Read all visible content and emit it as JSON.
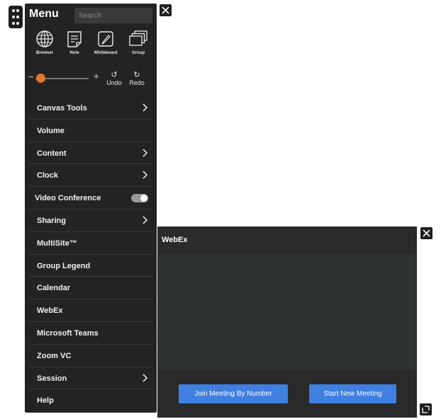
{
  "menu": {
    "title": "Menu",
    "search_placeholder": "Search",
    "apps": [
      {
        "label": "Browser",
        "icon": "globe-icon"
      },
      {
        "label": "Note",
        "icon": "note-icon"
      },
      {
        "label": "Whiteboard",
        "icon": "pen-icon"
      },
      {
        "label": "Group",
        "icon": "stack-icon"
      }
    ],
    "zoom": {
      "minus": "−",
      "plus": "+",
      "level": 0.02
    },
    "undo_label": "Undo",
    "redo_label": "Redo",
    "items": [
      {
        "label": "Canvas Tools",
        "submenu": true
      },
      {
        "label": "Volume",
        "submenu": false
      },
      {
        "label": "Content",
        "submenu": true
      },
      {
        "label": "Clock",
        "submenu": true
      },
      {
        "label": "Video Conference",
        "toggle": true,
        "toggle_on": false
      },
      {
        "label": "Sharing",
        "submenu": true
      },
      {
        "label": "MultiSite™",
        "submenu": false
      },
      {
        "label": "Group Legend",
        "submenu": false
      },
      {
        "label": "Calendar",
        "submenu": false
      },
      {
        "label": "WebEx",
        "submenu": false
      },
      {
        "label": "Microsoft Teams",
        "submenu": false
      },
      {
        "label": "Zoom VC",
        "submenu": false
      },
      {
        "label": "Session",
        "submenu": true
      },
      {
        "label": "Help",
        "submenu": false
      }
    ]
  },
  "webex": {
    "title": "WebEx",
    "join_label": "Join Meeting By Number",
    "start_label": "Start New Meeting"
  },
  "colors": {
    "panel": "#232323",
    "accent_slider": "#e2762f",
    "button_blue": "#3f7fe0"
  }
}
